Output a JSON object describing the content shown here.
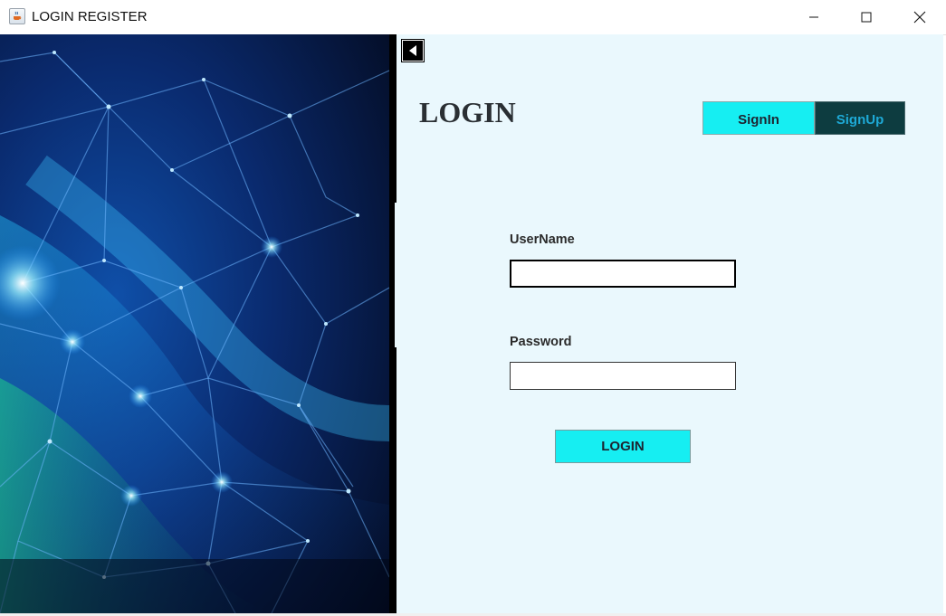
{
  "window": {
    "title": "LOGIN REGISTER",
    "app_icon": "java-cup-icon",
    "controls": {
      "minimize": "minimize-icon",
      "maximize": "maximize-icon",
      "close": "close-icon"
    }
  },
  "sidebar_image": {
    "description_icon": "network-background-image"
  },
  "back_button": {
    "icon": "back-arrow-icon"
  },
  "login": {
    "heading": "LOGIN",
    "tabs": {
      "signin": "SignIn",
      "signup": "SignUp"
    },
    "username_label": "UserName",
    "username_value": "",
    "password_label": "Password",
    "password_value": "",
    "submit_label": "LOGIN"
  },
  "colors": {
    "accent": "#16EEF2",
    "signup_bg": "#0D3C40",
    "signup_text": "#1EA9D6",
    "panel_bg": "#EAF8FD"
  }
}
